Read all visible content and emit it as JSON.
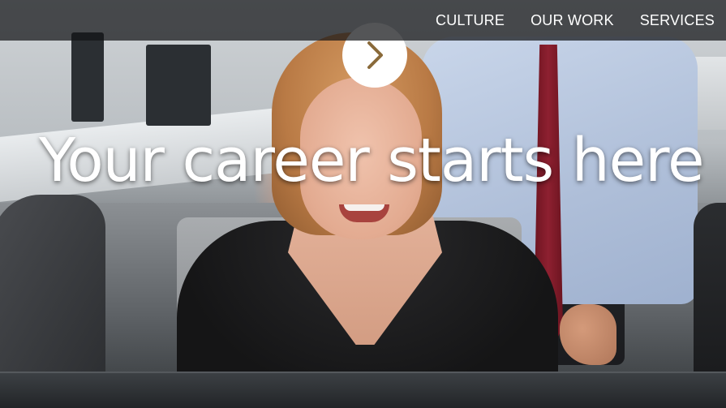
{
  "nav": {
    "items": [
      {
        "label": "CULTURE"
      },
      {
        "label": "OUR WORK"
      },
      {
        "label": "SERVICES"
      }
    ]
  },
  "hero": {
    "headline": "Your career starts here",
    "next_icon": "chevron-right-icon",
    "colors": {
      "nav_bg": "#121416",
      "text": "#ffffff",
      "chevron": "#8a6a3a"
    }
  }
}
